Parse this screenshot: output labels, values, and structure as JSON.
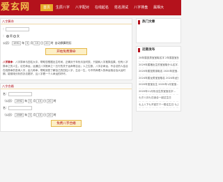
{
  "header": {
    "logo": "爱玄网",
    "nav": [
      {
        "label": "首页",
        "active": true
      },
      {
        "label": "生辰八字",
        "active": false
      },
      {
        "label": "八字配对",
        "active": false
      },
      {
        "label": "在线起名",
        "active": false
      },
      {
        "label": "姓名测试",
        "active": false
      },
      {
        "label": "八字排盘",
        "active": false
      },
      {
        "label": "属相大",
        "active": false
      }
    ]
  },
  "bazi_form": {
    "title": "八字算命",
    "name_label": "：",
    "gender_label": "：",
    "male_label": "男",
    "female_label": "女",
    "date_label": "公历）",
    "year": "1991",
    "year_unit": "年",
    "month": "5",
    "month_unit": "月",
    "day": "15",
    "day_unit": "日",
    "hour": "20",
    "hour_unit": "时",
    "suffix": "自动换算阴历",
    "submit_label": "开始免费算命"
  },
  "bazi_desc": {
    "lead": "八字算命",
    "body": "：八字算命与四柱大中，帮助您根据出生时间，正确对于年份月及时辰，只能转八字推算结果，但有八字算命之的人生，论在命运，运通过八字推命之一五行的关于运命等吉凶；人之生数，八字必命运，不合法的人结合在线算命的查询八字，由几种命，帮助到您了解自己的四柱八字，生合一生，与不同命理人的命运相合及大运时期，能够用分析的办法更好，且八字看一个人命运的好坏。"
  },
  "match_form": {
    "title": "八字合婚",
    "male_row": {
      "name_label": "名：",
      "date_label": "（公历）",
      "year": "1992",
      "year_unit": "年",
      "month": "5",
      "month_unit": "月",
      "day": "15",
      "day_unit": "日",
      "hour": "20",
      "hour_unit": "时"
    },
    "female_name_label": "名：",
    "female_row": {
      "date_label": "（公历）",
      "year": "1989",
      "year_unit": "年",
      "month": "5",
      "month_unit": "月",
      "day": "15",
      "day_unit": "日",
      "hour": "20",
      "hour_unit": "时"
    },
    "submit_label": "免费八字合婚"
  },
  "sidebar": {
    "hot": {
      "title": "热门文章"
    },
    "recent": {
      "title": "近期发布",
      "items": [
        "28年属鼠男宝宝取名字 2年属鼠宝宝...",
        "2029年属猪出生的宝宝取什么名字...",
        "2020年属鼠男孩取名 2020年鼠宝...",
        "2024年属龙男宝宝取名 2024年龙宝...",
        "2020年宝宝出生 2020年1月宝宝...",
        "2020年11月份出生的宝宝名字...",
        "七夕八月七日适合一起过生日",
        "七上八下七不宜打个一般往生日 七上..."
      ]
    }
  }
}
